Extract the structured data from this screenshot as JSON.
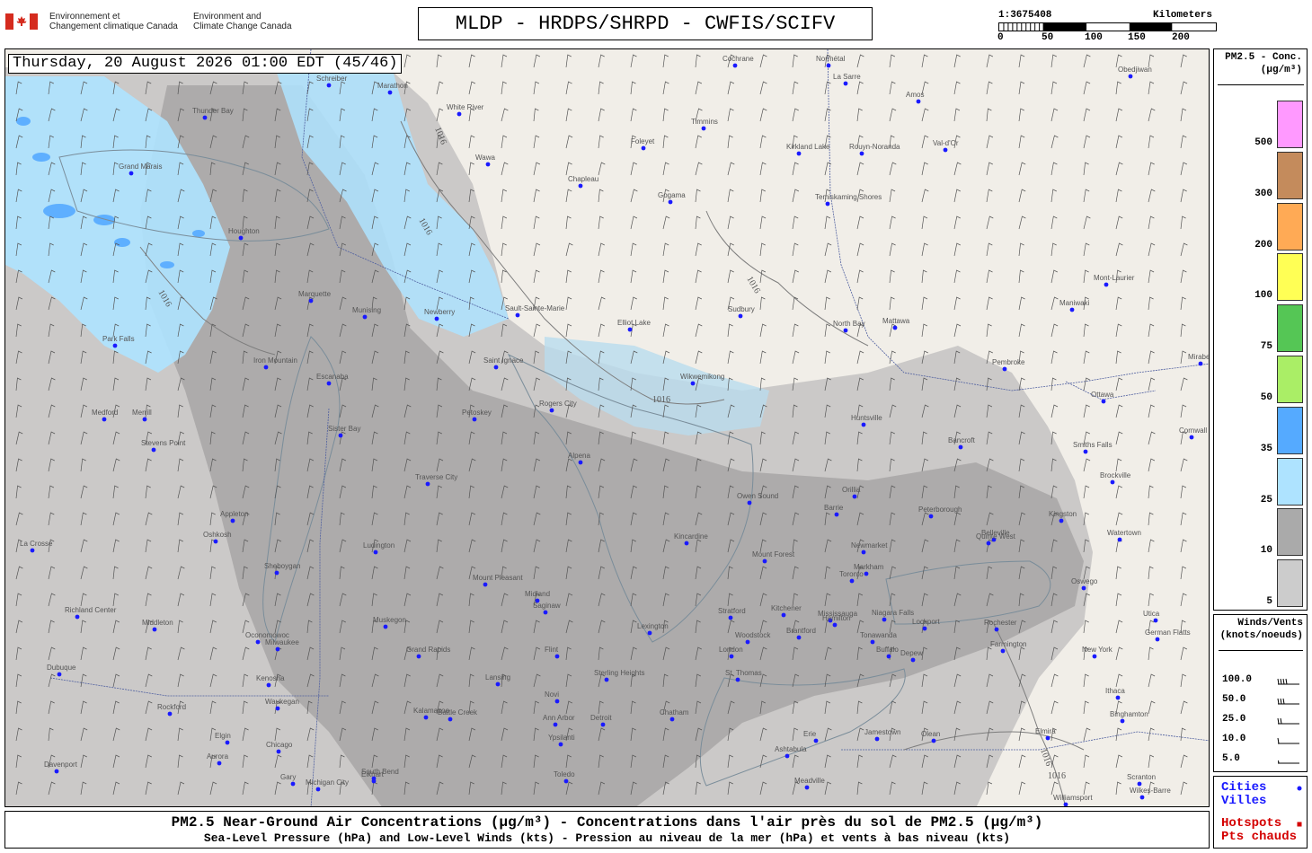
{
  "header": {
    "org_fr": [
      "Environnement et",
      "Changement climatique Canada"
    ],
    "org_en": [
      "Environment and",
      "Climate Change Canada"
    ],
    "title": "MLDP - HRDPS/SHRPD - CWFIS/SCIFV"
  },
  "scale": {
    "ratio": "1:3675408",
    "unit": "Kilometers",
    "ticks": [
      "0",
      "50",
      "100",
      "150",
      "200"
    ]
  },
  "map": {
    "datetime": "Thursday, 20 August 2026 01:00 EDT (45/46)",
    "isobar_labels": [
      "1016",
      "1016",
      "1016",
      "1016",
      "1016",
      "1016",
      "1016"
    ],
    "cities": [
      {
        "name": "Cochrane"
      },
      {
        "name": "Normétal"
      },
      {
        "name": "La Sarre"
      },
      {
        "name": "Amos"
      },
      {
        "name": "Obedjiwan"
      },
      {
        "name": "Schreiber"
      },
      {
        "name": "Marathon"
      },
      {
        "name": "White River"
      },
      {
        "name": "Timmins"
      },
      {
        "name": "Kirkland Lake"
      },
      {
        "name": "Rouyn-Noranda"
      },
      {
        "name": "Val-d'Or"
      },
      {
        "name": "Foleyet"
      },
      {
        "name": "Wawa"
      },
      {
        "name": "Chapleau"
      },
      {
        "name": "Gogama"
      },
      {
        "name": "Temiskaming Shores"
      },
      {
        "name": "Thunder Bay"
      },
      {
        "name": "Grand Marais"
      },
      {
        "name": "Houghton"
      },
      {
        "name": "Marquette"
      },
      {
        "name": "Munising"
      },
      {
        "name": "Newberry"
      },
      {
        "name": "Sault-Sainte-Marie"
      },
      {
        "name": "Elliot Lake"
      },
      {
        "name": "Sudbury"
      },
      {
        "name": "North Bay"
      },
      {
        "name": "Mattawa"
      },
      {
        "name": "Maniwaki"
      },
      {
        "name": "Mont-Laurier"
      },
      {
        "name": "Park Falls"
      },
      {
        "name": "Iron Mountain"
      },
      {
        "name": "Escanaba"
      },
      {
        "name": "Saint Ignace"
      },
      {
        "name": "Wikwemikong"
      },
      {
        "name": "Pembroke"
      },
      {
        "name": "Ottawa"
      },
      {
        "name": "Mirabel"
      },
      {
        "name": "Medford"
      },
      {
        "name": "Merrill"
      },
      {
        "name": "Petoskey"
      },
      {
        "name": "Rogers City"
      },
      {
        "name": "Huntsville"
      },
      {
        "name": "Sister Bay"
      },
      {
        "name": "Alpena"
      },
      {
        "name": "Bancroft"
      },
      {
        "name": "Smiths Falls"
      },
      {
        "name": "Cornwall"
      },
      {
        "name": "Brockville"
      },
      {
        "name": "Stevens Point"
      },
      {
        "name": "Traverse City"
      },
      {
        "name": "Owen Sound"
      },
      {
        "name": "Orillia"
      },
      {
        "name": "Barrie"
      },
      {
        "name": "Peterborough"
      },
      {
        "name": "Belleville"
      },
      {
        "name": "Kingston"
      },
      {
        "name": "Watertown"
      },
      {
        "name": "Appleton"
      },
      {
        "name": "Oshkosh"
      },
      {
        "name": "Kincardine"
      },
      {
        "name": "Newmarket"
      },
      {
        "name": "Quinte West"
      },
      {
        "name": "La Crosse"
      },
      {
        "name": "Sheboygan"
      },
      {
        "name": "Ludington"
      },
      {
        "name": "Mount Pleasant"
      },
      {
        "name": "Mount Forest"
      },
      {
        "name": "Markham"
      },
      {
        "name": "Toronto"
      },
      {
        "name": "Oswego"
      },
      {
        "name": "Midland"
      },
      {
        "name": "Saginaw"
      },
      {
        "name": "Kitchener"
      },
      {
        "name": "Mississauga"
      },
      {
        "name": "Richland Center"
      },
      {
        "name": "Muskegon"
      },
      {
        "name": "Stratford"
      },
      {
        "name": "Hamilton"
      },
      {
        "name": "Niagara Falls"
      },
      {
        "name": "Lockport"
      },
      {
        "name": "Rochester"
      },
      {
        "name": "Utica"
      },
      {
        "name": "Middleton"
      },
      {
        "name": "Oconomowoc"
      },
      {
        "name": "Milwaukee"
      },
      {
        "name": "Lexington"
      },
      {
        "name": "Woodstock"
      },
      {
        "name": "Brantford"
      },
      {
        "name": "Tonawanda"
      },
      {
        "name": "Buffalo"
      },
      {
        "name": "Depew"
      },
      {
        "name": "Farmington"
      },
      {
        "name": "German Flatts"
      },
      {
        "name": "Grand Rapids"
      },
      {
        "name": "Flint"
      },
      {
        "name": "London"
      },
      {
        "name": "New York"
      },
      {
        "name": "Dubuque"
      },
      {
        "name": "Kenosha"
      },
      {
        "name": "Lansing"
      },
      {
        "name": "Sterling Heights"
      },
      {
        "name": "St. Thomas"
      },
      {
        "name": "Ithaca"
      },
      {
        "name": "Waukegan"
      },
      {
        "name": "Novi"
      },
      {
        "name": "Rockford"
      },
      {
        "name": "Kalamazoo"
      },
      {
        "name": "Battle Creek"
      },
      {
        "name": "Ann Arbor"
      },
      {
        "name": "Detroit"
      },
      {
        "name": "Chatham"
      },
      {
        "name": "Binghamton"
      },
      {
        "name": "Elgin"
      },
      {
        "name": "Chicago"
      },
      {
        "name": "Ypsilanti"
      },
      {
        "name": "Erie"
      },
      {
        "name": "Jamestown"
      },
      {
        "name": "Olean"
      },
      {
        "name": "Elmira"
      },
      {
        "name": "Aurora"
      },
      {
        "name": "Ashtabula"
      },
      {
        "name": "South Bend"
      },
      {
        "name": "Gary"
      },
      {
        "name": "Michigan City"
      },
      {
        "name": "Elkhart"
      },
      {
        "name": "Toledo"
      },
      {
        "name": "Davenport"
      },
      {
        "name": "Meadville"
      },
      {
        "name": "Scranton"
      },
      {
        "name": "Wilkes-Barre"
      },
      {
        "name": "Williamsport"
      }
    ]
  },
  "legend": {
    "pm_title_1": "PM2.5 - Conc.",
    "pm_title_2": "(µg/m³)",
    "pm_levels": [
      {
        "label": "500",
        "color": "#ff99ff"
      },
      {
        "label": "300",
        "color": "#c48b5c"
      },
      {
        "label": "200",
        "color": "#ffaa55"
      },
      {
        "label": "100",
        "color": "#ffff55"
      },
      {
        "label": "75",
        "color": "#55c655"
      },
      {
        "label": "50",
        "color": "#aaee66"
      },
      {
        "label": "35",
        "color": "#55aaff"
      },
      {
        "label": "25",
        "color": "#aee3ff"
      },
      {
        "label": "10",
        "color": "#aaaaaa"
      },
      {
        "label": "5",
        "color": "#cccccc"
      }
    ],
    "wind_title_1": "Winds/Vents",
    "wind_title_2": "(knots/noeuds)",
    "wind_levels": [
      "100.0",
      "50.0",
      "25.0",
      "10.0",
      "5.0"
    ],
    "cities_label_1": "Cities",
    "cities_label_2": "Villes",
    "hotspots_label_1": "Hotspots",
    "hotspots_label_2": "Pts chauds",
    "city_dot_color": "#1a1aff",
    "hotspot_color": "#d40000"
  },
  "footer": {
    "line1": "PM2.5 Near-Ground Air Concentrations (µg/m³) - Concentrations dans l'air près du sol de PM2.5 (µg/m³)",
    "line2": "Sea-Level Pressure (hPa) and Low-Level Winds (kts) - Pression au niveau de la mer (hPa) et vents à bas niveau (kts)"
  }
}
